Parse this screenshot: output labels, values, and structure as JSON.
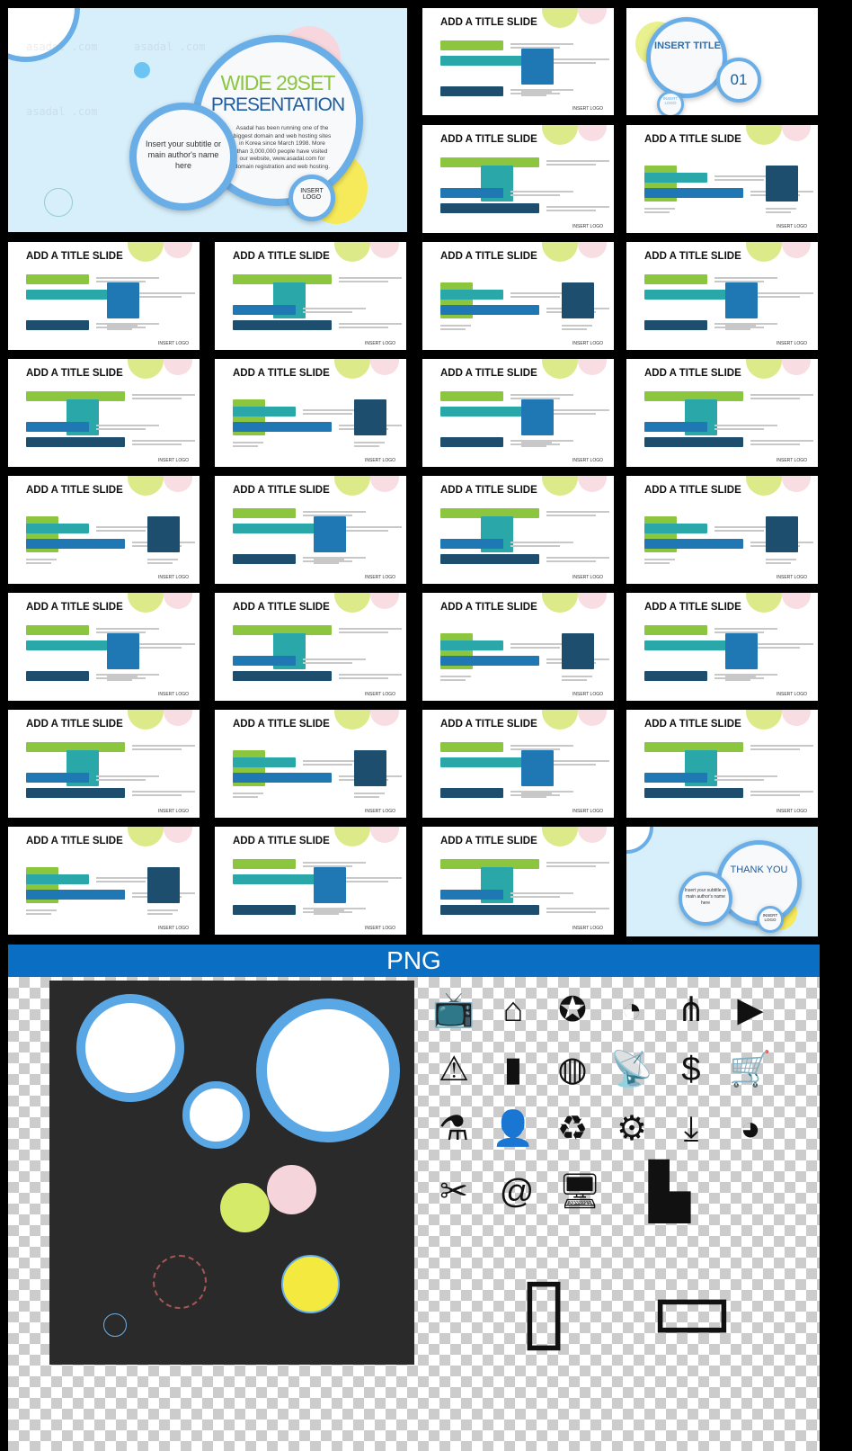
{
  "cover": {
    "title_line1": "WIDE 29SET",
    "title_line2": "PRESENTATION",
    "body": "Asadal has been running one of the biggest domain and web hosting sites in Korea since March 1998. More than 3,000,000 people have visited our website, www.asadal.com for domain registration and web hosting.",
    "subtitle": "Insert your subtitle or main author's name here",
    "logo": "INSERT LOGO",
    "watermark": "asadal .com"
  },
  "section_slide": {
    "title": "INSERT TITLE",
    "number": "01",
    "logo": "INSERT LOGO"
  },
  "thank_you": {
    "title": "THANK YOU",
    "subtitle": "Insert your subtitle or main author's name here",
    "logo": "INSERT LOGO"
  },
  "slide_title": "ADD A TITLE SLIDE",
  "slide_logo": "INSERT LOGO",
  "content_slide_count": 26,
  "png_section": {
    "label": "PNG"
  },
  "colors": {
    "green": "#8cc63f",
    "teal": "#2aa7a9",
    "blue": "#1f77b4",
    "navy": "#1d4e6e",
    "accent": "#0a6fc2"
  },
  "png_icons": [
    "tv-icon",
    "home-icon",
    "award-badge-icon",
    "rss-icon",
    "share-icon",
    "video-icon",
    "warning-icon",
    "battery-icon",
    "globe-icon",
    "satellite-dish-icon",
    "money-bag-icon",
    "shopping-cart-icon",
    "flask-icon",
    "add-user-icon",
    "recycle-bin-icon",
    "gear-icon",
    "download-icon",
    "pie-chart-icon",
    "tools-icon",
    "email-globe-icon",
    "computer-icon",
    "city-skyline-icon",
    "smartphone-icon",
    "monitor-icon"
  ]
}
